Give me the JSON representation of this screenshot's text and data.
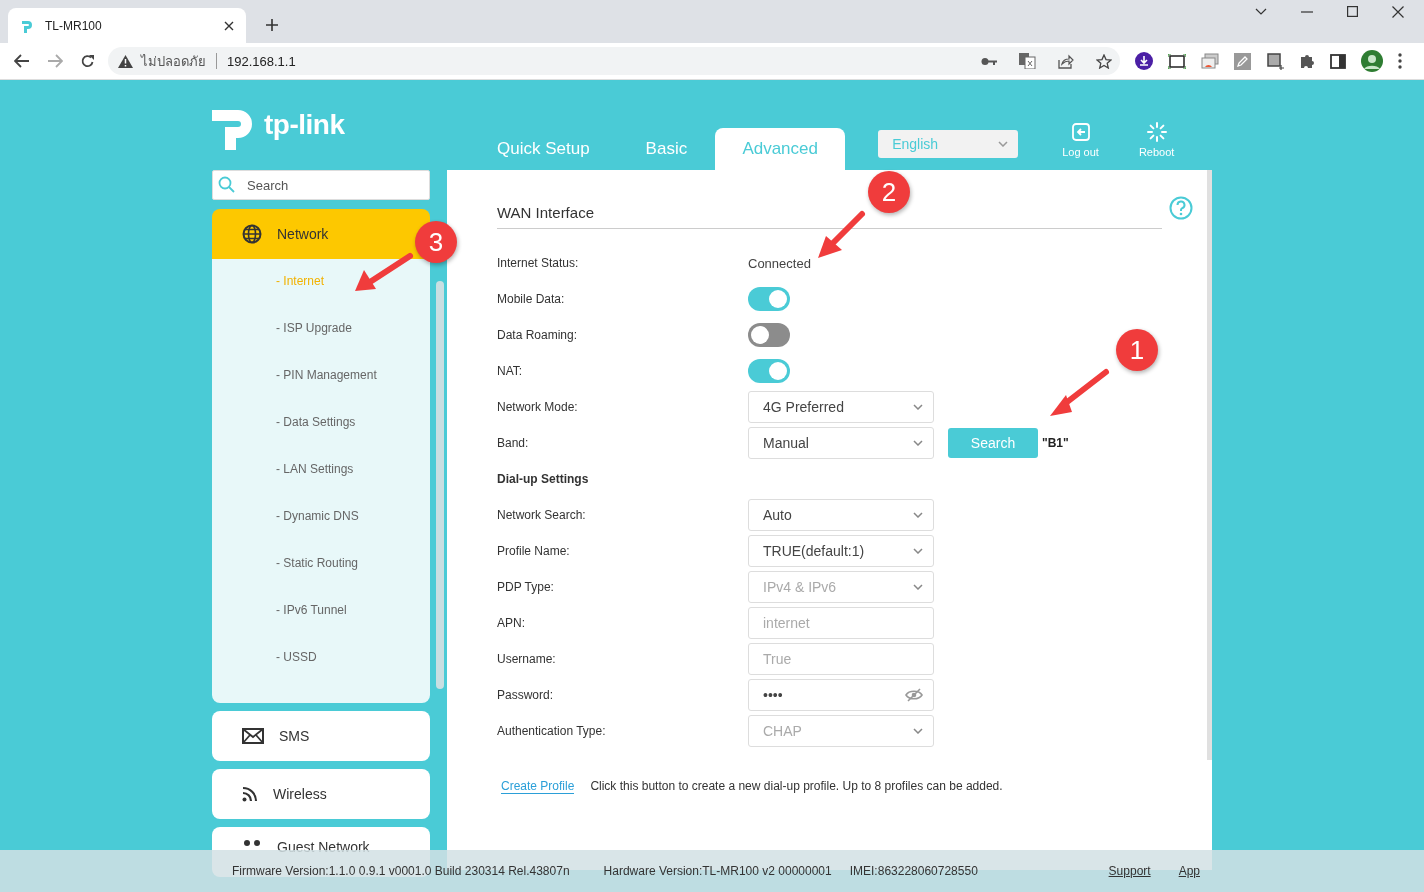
{
  "browser": {
    "tab_title": "TL-MR100",
    "security_label": "ไม่ปลอดภัย",
    "url": "192.168.1.1"
  },
  "header": {
    "brand": "tp-link",
    "nav_tabs": [
      {
        "label": "Quick Setup",
        "selected": false
      },
      {
        "label": "Basic",
        "selected": false
      },
      {
        "label": "Advanced",
        "selected": true
      }
    ],
    "language": "English",
    "actions": [
      {
        "label": "Log out",
        "kind": "logout"
      },
      {
        "label": "Reboot",
        "kind": "reboot"
      }
    ]
  },
  "sidebar": {
    "search_placeholder": "Search",
    "sections": [
      {
        "label": "Network",
        "kind": "globe",
        "expanded": true,
        "children": [
          {
            "label": "- Internet",
            "selected": true
          },
          {
            "label": "- ISP Upgrade",
            "selected": false
          },
          {
            "label": "- PIN Management",
            "selected": false
          },
          {
            "label": "- Data Settings",
            "selected": false
          },
          {
            "label": "- LAN Settings",
            "selected": false
          },
          {
            "label": "- Dynamic DNS",
            "selected": false
          },
          {
            "label": "- Static Routing",
            "selected": false
          },
          {
            "label": "- IPv6 Tunnel",
            "selected": false
          },
          {
            "label": "- USSD",
            "selected": false
          }
        ]
      },
      {
        "label": "SMS",
        "kind": "mail",
        "expanded": false
      },
      {
        "label": "Wireless",
        "kind": "wifi",
        "expanded": false
      },
      {
        "label": "Guest Network",
        "kind": "guests",
        "expanded": false
      }
    ]
  },
  "main": {
    "title": "WAN Interface",
    "rows": [
      {
        "kind": "text",
        "label": "Internet Status:",
        "value": "Connected"
      },
      {
        "kind": "toggle",
        "label": "Mobile Data:",
        "on": true
      },
      {
        "kind": "toggle",
        "label": "Data Roaming:",
        "on": false
      },
      {
        "kind": "toggle",
        "label": "NAT:",
        "on": true
      },
      {
        "kind": "select",
        "label": "Network Mode:",
        "value": "4G Preferred",
        "disabled": false
      },
      {
        "kind": "select",
        "label": "Band:",
        "value": "Manual",
        "disabled": false,
        "button": "Search",
        "note": "\"B1\""
      },
      {
        "kind": "heading",
        "label": "Dial-up Settings"
      },
      {
        "kind": "select",
        "label": "Network Search:",
        "value": "Auto",
        "disabled": false
      },
      {
        "kind": "select",
        "label": "Profile Name:",
        "value": "TRUE(default:1)",
        "disabled": false
      },
      {
        "kind": "select",
        "label": "PDP Type:",
        "value": "IPv4 & IPv6",
        "disabled": true
      },
      {
        "kind": "input",
        "label": "APN:",
        "value": "internet",
        "disabled": true
      },
      {
        "kind": "input",
        "label": "Username:",
        "value": "True",
        "disabled": true
      },
      {
        "kind": "password",
        "label": "Password:",
        "value": "••••",
        "disabled": false
      },
      {
        "kind": "select",
        "label": "Authentication Type:",
        "value": "CHAP",
        "disabled": true
      }
    ],
    "create_profile": {
      "link": "Create Profile",
      "text": "Click this button to create a new dial-up profile. Up to 8 profiles can be added."
    }
  },
  "footer": {
    "firmware": "Firmware Version:1.1.0 0.9.1 v0001.0 Build 230314 Rel.43807n",
    "hardware": "Hardware Version:TL-MR100 v2 00000001",
    "imei": "IMEI:863228060728550",
    "links": [
      "Support",
      "App"
    ]
  },
  "annotations": [
    {
      "number": "1"
    },
    {
      "number": "2"
    },
    {
      "number": "3"
    }
  ]
}
